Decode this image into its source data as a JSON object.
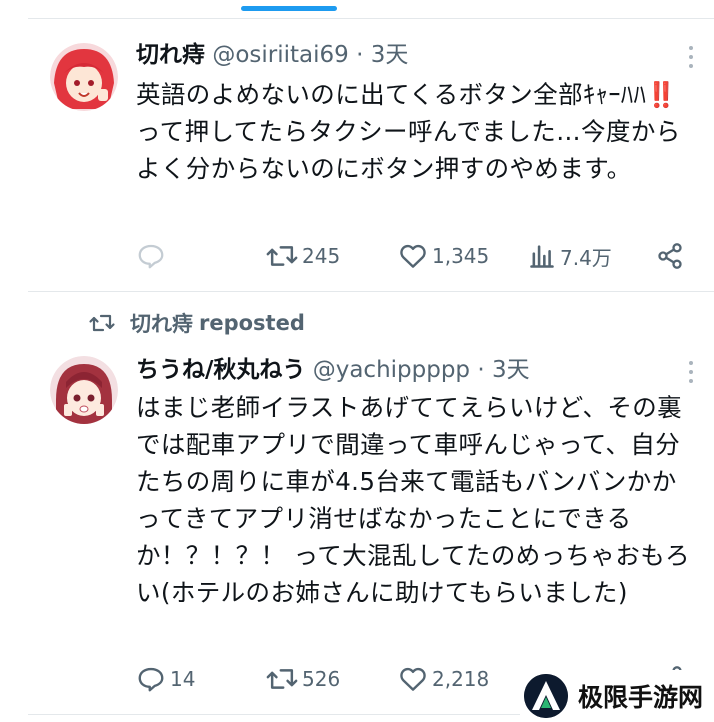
{
  "tweets": [
    {
      "author_name": "切れ痔",
      "handle": "@osiriitai69",
      "separator": "·",
      "time": "3天",
      "text": "英語のよめないのに出てくるボタン全部ｷｬｰﾊﾊ‼️って押してたらタクシー呼んでました…今度からよく分からないのにボタン押すのやめます。",
      "replies": "",
      "reposts": "245",
      "likes": "1,345",
      "views": "7.4万"
    },
    {
      "author_name": "ちうね/秋丸ねう",
      "handle": "@yachippppp",
      "separator": "·",
      "time": "3天",
      "text": "はまじ老師イラストあげててえらいけど、その裏では配車アプリで間違って車呼んじゃって、自分たちの周りに車が4.5台来て電話もバンバンかかってきてアプリ消せばなかったことにできるか！？！？！ って大混乱してたのめっちゃおもろい(ホテルのお姉さんに助けてもらいました)",
      "replies": "14",
      "reposts": "526",
      "likes": "2,218"
    }
  ],
  "repost_banner": {
    "reposter": "切れ痔",
    "label": "reposted"
  },
  "watermark": {
    "text": "极限手游网"
  },
  "colors": {
    "accent": "#1d9bf0",
    "text": "#0f1419",
    "muted": "#536471",
    "divider": "#e4e8eb"
  },
  "icons": [
    "reply-icon",
    "repost-icon",
    "like-icon",
    "views-icon",
    "share-icon",
    "more-icon"
  ]
}
